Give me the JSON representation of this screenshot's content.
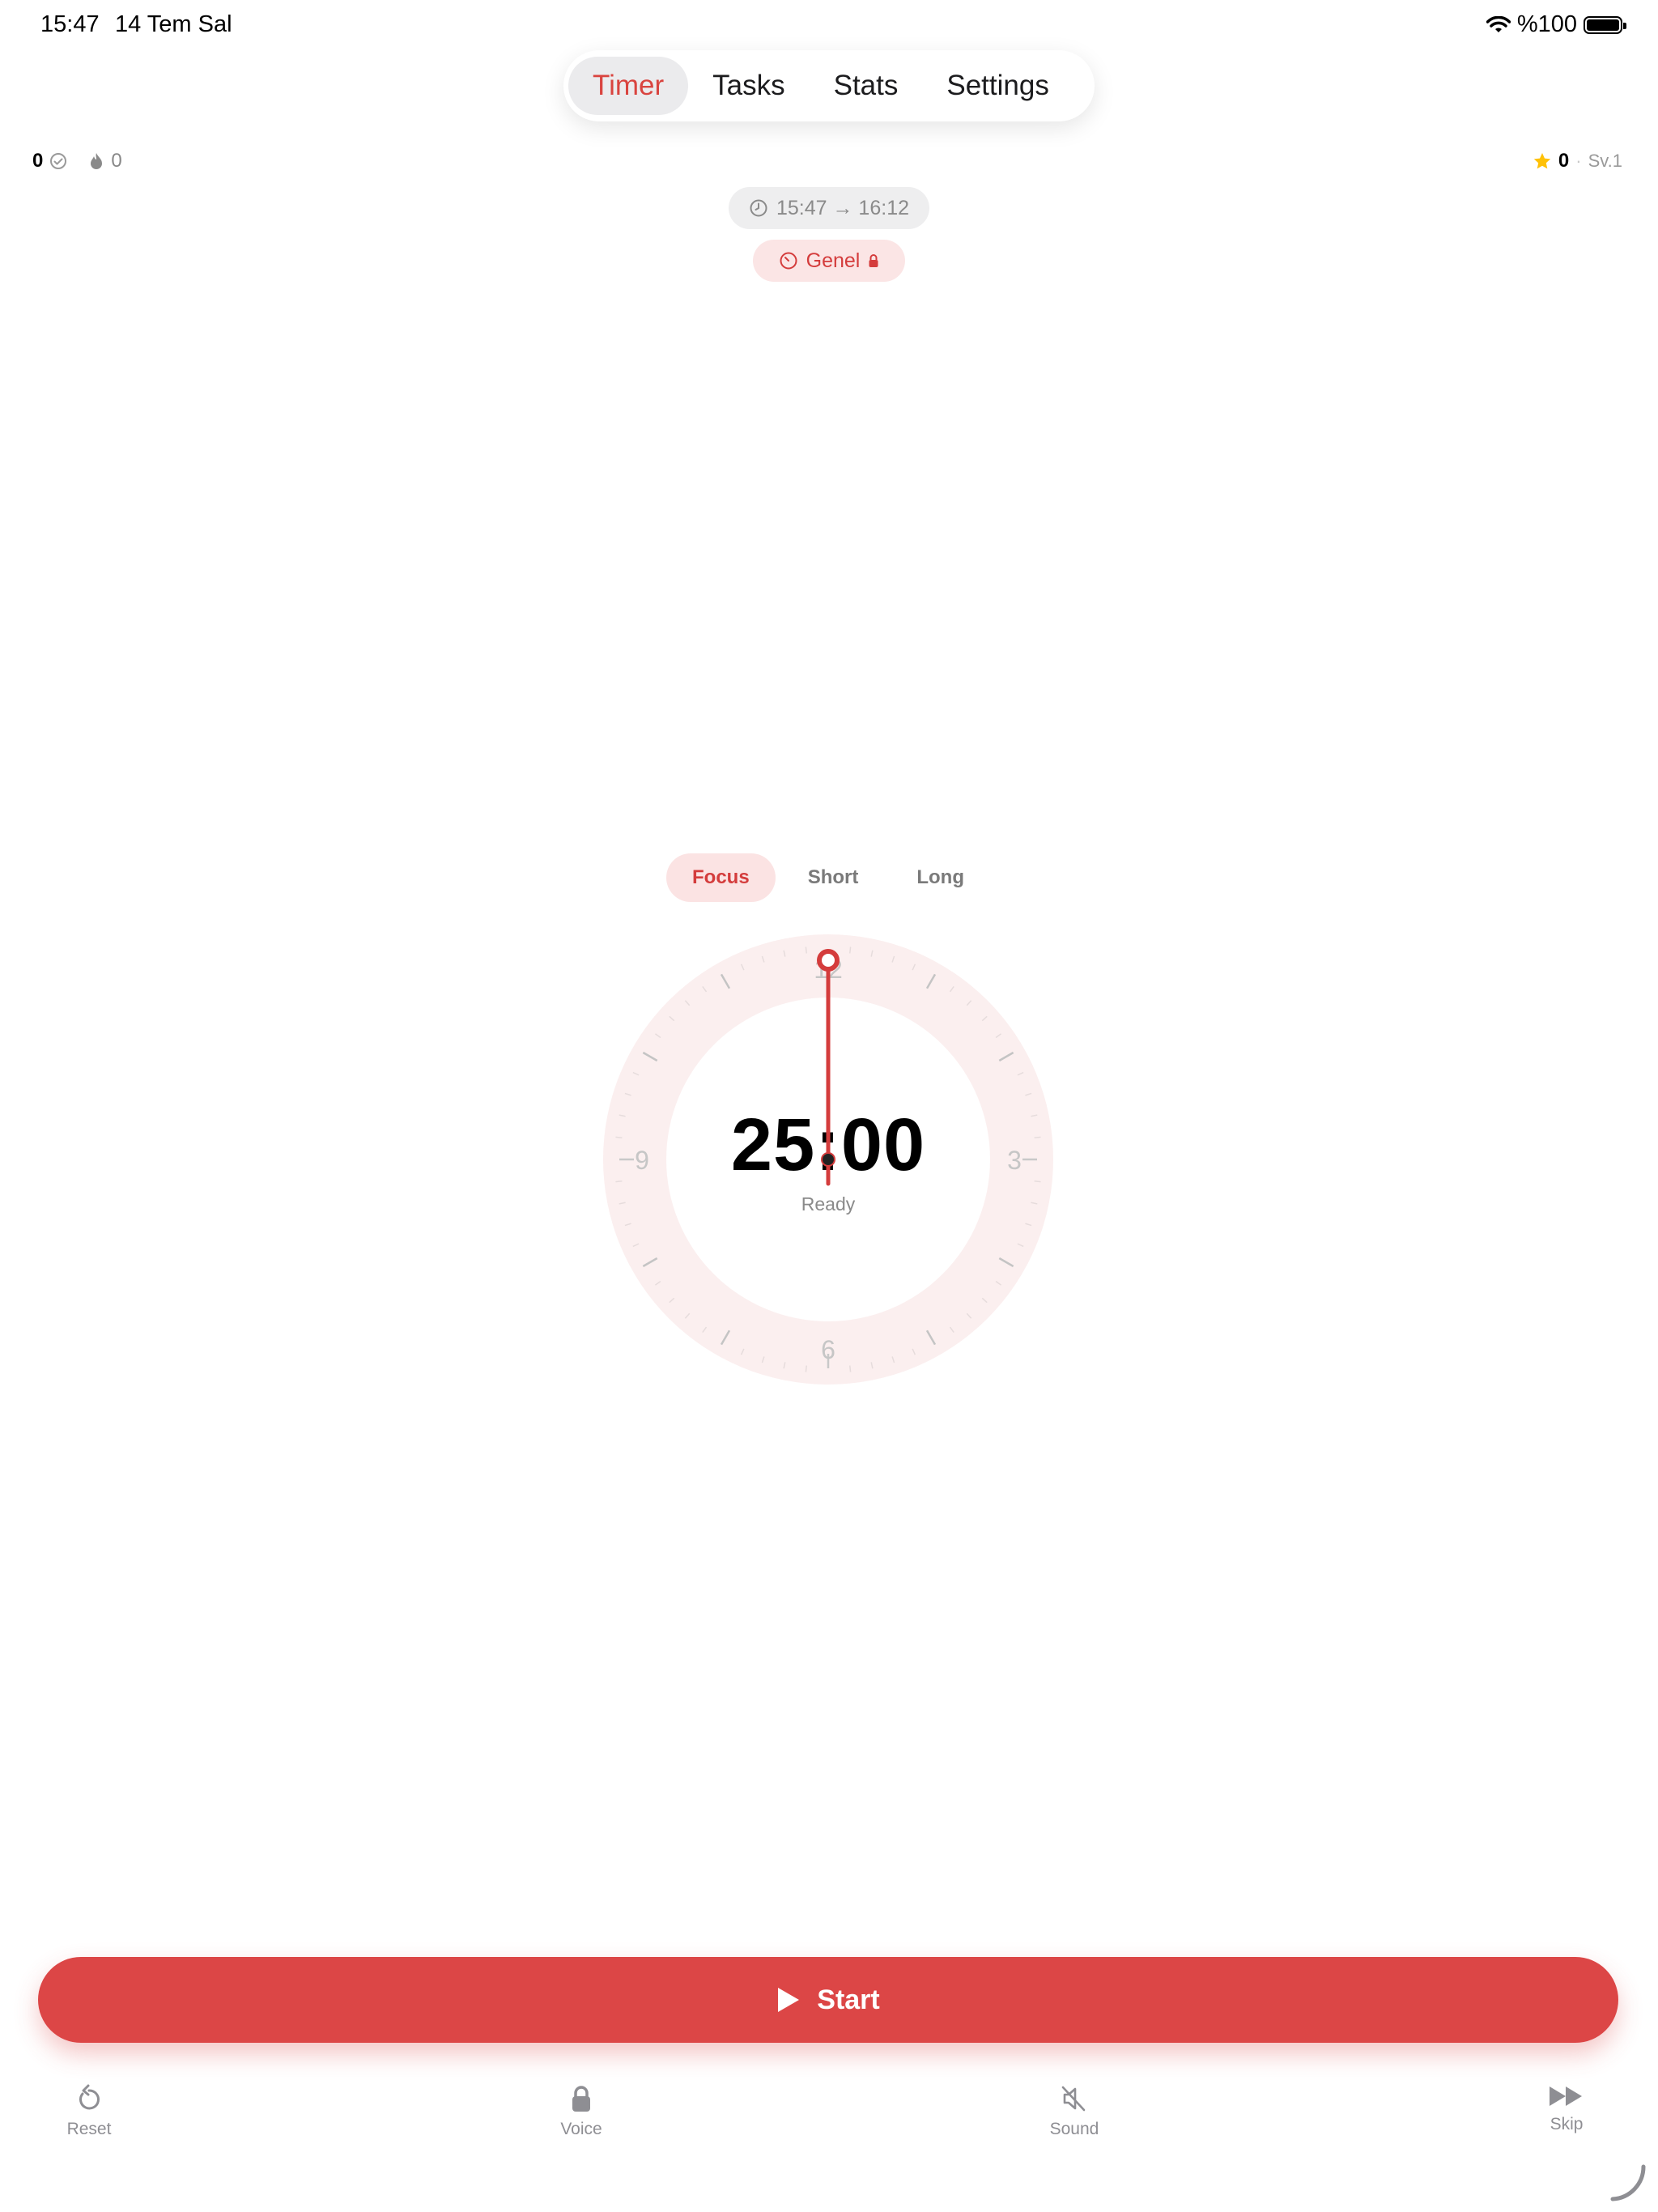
{
  "status_bar": {
    "time": "15:47",
    "date": "14 Tem Sal",
    "battery": "%100",
    "icons": [
      "wifi-icon",
      "battery-icon"
    ]
  },
  "tabs": [
    {
      "label": "Timer",
      "active": true
    },
    {
      "label": "Tasks",
      "active": false
    },
    {
      "label": "Stats",
      "active": false
    },
    {
      "label": "Settings",
      "active": false
    }
  ],
  "stats": {
    "completed_count": "0",
    "streak_count": "0",
    "stars": "0",
    "level": "Sv.1"
  },
  "session": {
    "time_range": "15:47 → 16:12",
    "category": "Genel"
  },
  "modes": [
    {
      "label": "Focus",
      "active": true
    },
    {
      "label": "Short",
      "active": false
    },
    {
      "label": "Long",
      "active": false
    }
  ],
  "clock": {
    "numbers": {
      "twelve": "12",
      "three": "3",
      "six": "6",
      "nine": "9"
    },
    "remaining": "25:00",
    "state": "Ready"
  },
  "start_button": {
    "label": "Start"
  },
  "toolbar": {
    "reset": "Reset",
    "voice": "Voice",
    "sound": "Sound",
    "skip": "Skip"
  },
  "colors": {
    "accent": "#DC4646",
    "accent_light": "#FBE3E3",
    "star": "#FFC107"
  }
}
